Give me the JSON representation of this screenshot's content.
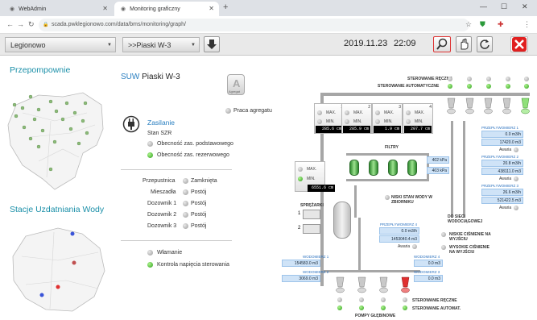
{
  "browser": {
    "tabs": [
      {
        "title": "WebAdmin"
      },
      {
        "title": "Monitoring graficzny"
      }
    ],
    "url": "scada.pwklegionowo.com/data/bms/monitoring/graph/"
  },
  "header": {
    "location_select": "Legionowo",
    "station_select": ">>Piaski W-3",
    "date": "2019.11.23",
    "time": "22:09"
  },
  "left": {
    "title_pumps": "Przepompownie",
    "title_suw": "Stacje Uzdatniania Wody"
  },
  "center": {
    "suw_prefix": "SUW",
    "suw_name": "Piaski W-3",
    "agregat_label": "Agregat",
    "praca_agregatu": "Praca agregatu",
    "zasilanie_title": "Zasilanie",
    "stan_szr": "Stan SZR",
    "obecnosc_podst": "Obecność zas. podstawowego",
    "obecnosc_rez": "Obecność zas. rezerwowego",
    "przepustnica": "Przepustnica",
    "przepustnica_state": "Zamknięta",
    "mieszadla": "Mieszadła",
    "postoj": "Postój",
    "dozownik1": "Dozownik 1",
    "dozownik2": "Dozownik 2",
    "dozownik3": "Dozownik 3",
    "wlamanie": "Włamanie",
    "kontrola": "Kontrola napięcia sterowania"
  },
  "right": {
    "sterowanie_reczne": "STEROWANIE RĘCZNE",
    "sterowanie_auto": "STEROWANIE AUTOMATYCZNE",
    "sterowanie_reczne_bottom": "STEROWANIE RĘCZNE",
    "sterowanie_auto_bottom": "STEROWANIE AUTOMAT.",
    "max": "MAX.",
    "min": "MIN.",
    "gauges": [
      {
        "value": "285.6 cm",
        "name": "1"
      },
      {
        "value": "285.9 cm",
        "name": "2"
      },
      {
        "value": "1.9 cm",
        "name": "3"
      },
      {
        "value": "207.7 cm",
        "name": "4"
      }
    ],
    "tank_gauge": {
      "value": "6551.6 cm"
    },
    "filtry": "FILTRY",
    "pressure1": "402 kPa",
    "pressure2": "403 kPa",
    "niski_stan": "NISKI STAN WODY W ZBIORNIKU",
    "sprezarki": "SPRĘŻARKI",
    "do_sieci": "DO SIECI WODOCIĄGOWEJ",
    "niskie_cis": "NISKIE CIŚNIENIE NA WYJŚCIU",
    "wysokie_cis": "WYSOKIE CIŚNIENIE NA WYJŚCIU",
    "pompy": "POMPY GŁĘBINOWE",
    "awaria": "Awaria",
    "przeplyw_right": [
      {
        "label": "PRZEPŁYWOMIERZ 1",
        "v1": "0.0 m3/h",
        "v2": "17420.0 m3"
      },
      {
        "label": "PRZEPŁYWOMIERZ 2",
        "v1": "20.8 m3/h",
        "v2": "438111.0 m3"
      },
      {
        "label": "PRZEPŁYWOMIERZ 3",
        "v1": "26.6 m3/h",
        "v2": "521422.5 m3"
      }
    ],
    "przeplyw_mid": {
      "label": "PRZEPŁYWOMIERZ 4",
      "v1": "0.0 m3/h",
      "v2": "1453040.4 m3"
    },
    "wodomierz": [
      {
        "label": "WODOMIERZ 1",
        "value": "154583.0 m3"
      },
      {
        "label": "WODOMIERZ 2",
        "value": "3069.0 m3"
      },
      {
        "label": "WODOMIERZ 4",
        "value": "0.0 m3"
      },
      {
        "label": "WODOMIERZ 3",
        "value": "0.0 m3"
      }
    ]
  }
}
